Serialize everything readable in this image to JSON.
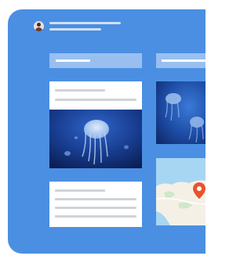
{
  "icons": {
    "avatar": "avatar-icon",
    "pin": "map-pin-icon"
  },
  "colors": {
    "panel": "#4b8fe3",
    "column_header": "#98bff0",
    "card": "#ffffff",
    "placeholder_line": "#cfd3d8",
    "jellyfish_water": "#1b3f8f",
    "map_water": "#a7d6f2",
    "map_land": "#f4f0e6",
    "pin": "#e8532e"
  }
}
